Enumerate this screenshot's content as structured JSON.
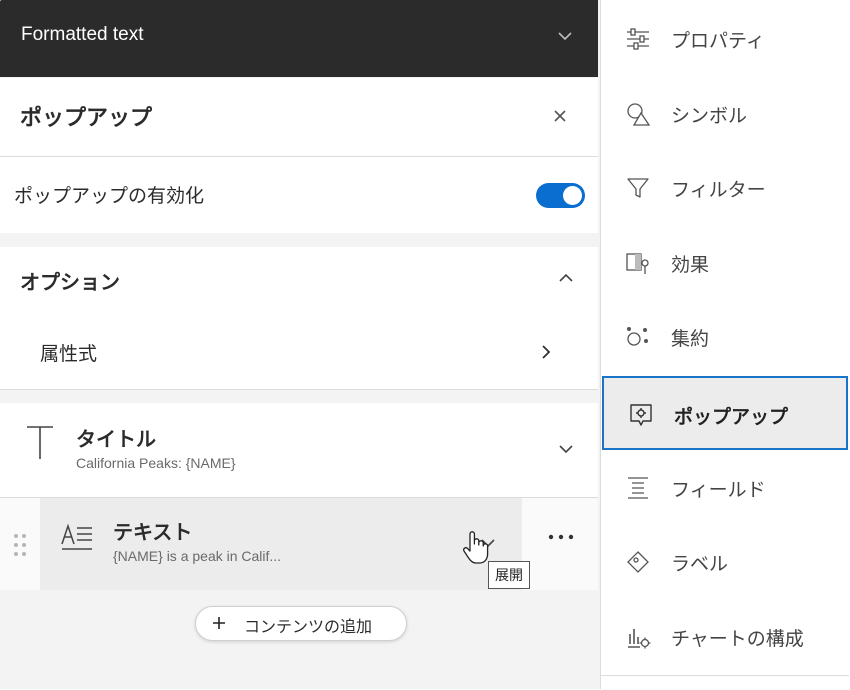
{
  "header": {
    "dropdown_label": "Formatted text"
  },
  "panel": {
    "title": "ポップアップ",
    "enable_label": "ポップアップの有効化",
    "enabled": true,
    "options_heading": "オプション",
    "attribute_expressions": "属性式"
  },
  "elements": [
    {
      "type": "title",
      "name": "タイトル",
      "subtitle": "California Peaks: {NAME}"
    },
    {
      "type": "text",
      "name": "テキスト",
      "subtitle": "{NAME} is a peak in Calif..."
    }
  ],
  "tooltip": "展開",
  "add_content": "コンテンツの追加",
  "rail": [
    {
      "label": "プロパティ",
      "icon": "sliders-icon"
    },
    {
      "label": "シンボル",
      "icon": "shapes-icon"
    },
    {
      "label": "フィルター",
      "icon": "filter-icon"
    },
    {
      "label": "効果",
      "icon": "effects-icon"
    },
    {
      "label": "集約",
      "icon": "aggregation-icon"
    },
    {
      "label": "ポップアップ",
      "icon": "popup-icon",
      "active": true
    },
    {
      "label": "フィールド",
      "icon": "fields-icon"
    },
    {
      "label": "ラベル",
      "icon": "label-icon"
    },
    {
      "label": "チャートの構成",
      "icon": "chart-config-icon"
    }
  ],
  "colors": {
    "accent": "#1a73c7",
    "toggle": "#0a6ed1",
    "dark_bar": "#2b2b2b"
  }
}
